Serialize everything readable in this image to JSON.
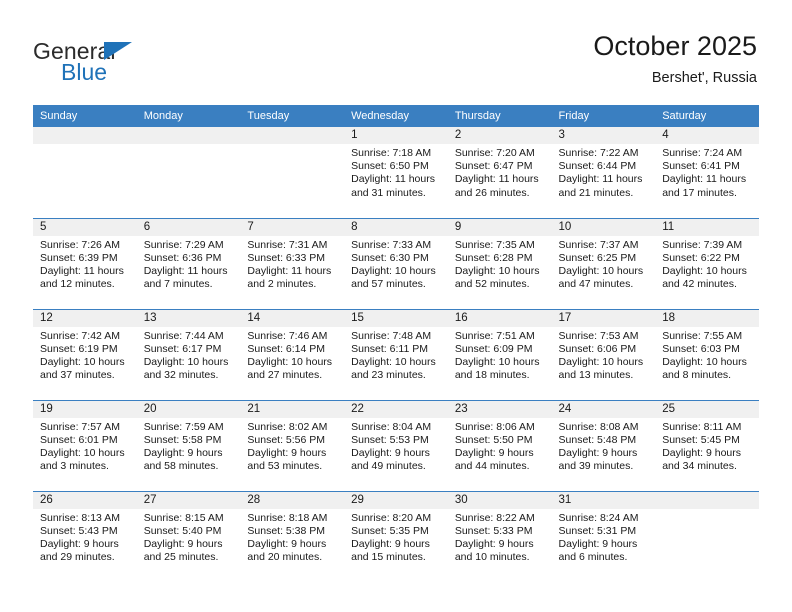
{
  "brand": {
    "name_top": "General",
    "name_bottom": "Blue",
    "accent_color": "#1f72b8",
    "triangle_icon": "brand-triangle-icon"
  },
  "header": {
    "title": "October 2025",
    "subtitle": "Bershet', Russia"
  },
  "calendar": {
    "header_bg": "#3a7fc1",
    "daynum_bg": "#f0f0f0",
    "weekday_headers": [
      "Sunday",
      "Monday",
      "Tuesday",
      "Wednesday",
      "Thursday",
      "Friday",
      "Saturday"
    ],
    "weeks": [
      [
        {
          "day": "",
          "empty": true,
          "sunrise": "",
          "sunset": "",
          "daylight_1": "",
          "daylight_2": ""
        },
        {
          "day": "",
          "empty": true,
          "sunrise": "",
          "sunset": "",
          "daylight_1": "",
          "daylight_2": ""
        },
        {
          "day": "",
          "empty": true,
          "sunrise": "",
          "sunset": "",
          "daylight_1": "",
          "daylight_2": ""
        },
        {
          "day": "1",
          "empty": false,
          "sunrise": "Sunrise: 7:18 AM",
          "sunset": "Sunset: 6:50 PM",
          "daylight_1": "Daylight: 11 hours",
          "daylight_2": "and 31 minutes."
        },
        {
          "day": "2",
          "empty": false,
          "sunrise": "Sunrise: 7:20 AM",
          "sunset": "Sunset: 6:47 PM",
          "daylight_1": "Daylight: 11 hours",
          "daylight_2": "and 26 minutes."
        },
        {
          "day": "3",
          "empty": false,
          "sunrise": "Sunrise: 7:22 AM",
          "sunset": "Sunset: 6:44 PM",
          "daylight_1": "Daylight: 11 hours",
          "daylight_2": "and 21 minutes."
        },
        {
          "day": "4",
          "empty": false,
          "sunrise": "Sunrise: 7:24 AM",
          "sunset": "Sunset: 6:41 PM",
          "daylight_1": "Daylight: 11 hours",
          "daylight_2": "and 17 minutes."
        }
      ],
      [
        {
          "day": "5",
          "empty": false,
          "sunrise": "Sunrise: 7:26 AM",
          "sunset": "Sunset: 6:39 PM",
          "daylight_1": "Daylight: 11 hours",
          "daylight_2": "and 12 minutes."
        },
        {
          "day": "6",
          "empty": false,
          "sunrise": "Sunrise: 7:29 AM",
          "sunset": "Sunset: 6:36 PM",
          "daylight_1": "Daylight: 11 hours",
          "daylight_2": "and 7 minutes."
        },
        {
          "day": "7",
          "empty": false,
          "sunrise": "Sunrise: 7:31 AM",
          "sunset": "Sunset: 6:33 PM",
          "daylight_1": "Daylight: 11 hours",
          "daylight_2": "and 2 minutes."
        },
        {
          "day": "8",
          "empty": false,
          "sunrise": "Sunrise: 7:33 AM",
          "sunset": "Sunset: 6:30 PM",
          "daylight_1": "Daylight: 10 hours",
          "daylight_2": "and 57 minutes."
        },
        {
          "day": "9",
          "empty": false,
          "sunrise": "Sunrise: 7:35 AM",
          "sunset": "Sunset: 6:28 PM",
          "daylight_1": "Daylight: 10 hours",
          "daylight_2": "and 52 minutes."
        },
        {
          "day": "10",
          "empty": false,
          "sunrise": "Sunrise: 7:37 AM",
          "sunset": "Sunset: 6:25 PM",
          "daylight_1": "Daylight: 10 hours",
          "daylight_2": "and 47 minutes."
        },
        {
          "day": "11",
          "empty": false,
          "sunrise": "Sunrise: 7:39 AM",
          "sunset": "Sunset: 6:22 PM",
          "daylight_1": "Daylight: 10 hours",
          "daylight_2": "and 42 minutes."
        }
      ],
      [
        {
          "day": "12",
          "empty": false,
          "sunrise": "Sunrise: 7:42 AM",
          "sunset": "Sunset: 6:19 PM",
          "daylight_1": "Daylight: 10 hours",
          "daylight_2": "and 37 minutes."
        },
        {
          "day": "13",
          "empty": false,
          "sunrise": "Sunrise: 7:44 AM",
          "sunset": "Sunset: 6:17 PM",
          "daylight_1": "Daylight: 10 hours",
          "daylight_2": "and 32 minutes."
        },
        {
          "day": "14",
          "empty": false,
          "sunrise": "Sunrise: 7:46 AM",
          "sunset": "Sunset: 6:14 PM",
          "daylight_1": "Daylight: 10 hours",
          "daylight_2": "and 27 minutes."
        },
        {
          "day": "15",
          "empty": false,
          "sunrise": "Sunrise: 7:48 AM",
          "sunset": "Sunset: 6:11 PM",
          "daylight_1": "Daylight: 10 hours",
          "daylight_2": "and 23 minutes."
        },
        {
          "day": "16",
          "empty": false,
          "sunrise": "Sunrise: 7:51 AM",
          "sunset": "Sunset: 6:09 PM",
          "daylight_1": "Daylight: 10 hours",
          "daylight_2": "and 18 minutes."
        },
        {
          "day": "17",
          "empty": false,
          "sunrise": "Sunrise: 7:53 AM",
          "sunset": "Sunset: 6:06 PM",
          "daylight_1": "Daylight: 10 hours",
          "daylight_2": "and 13 minutes."
        },
        {
          "day": "18",
          "empty": false,
          "sunrise": "Sunrise: 7:55 AM",
          "sunset": "Sunset: 6:03 PM",
          "daylight_1": "Daylight: 10 hours",
          "daylight_2": "and 8 minutes."
        }
      ],
      [
        {
          "day": "19",
          "empty": false,
          "sunrise": "Sunrise: 7:57 AM",
          "sunset": "Sunset: 6:01 PM",
          "daylight_1": "Daylight: 10 hours",
          "daylight_2": "and 3 minutes."
        },
        {
          "day": "20",
          "empty": false,
          "sunrise": "Sunrise: 7:59 AM",
          "sunset": "Sunset: 5:58 PM",
          "daylight_1": "Daylight: 9 hours",
          "daylight_2": "and 58 minutes."
        },
        {
          "day": "21",
          "empty": false,
          "sunrise": "Sunrise: 8:02 AM",
          "sunset": "Sunset: 5:56 PM",
          "daylight_1": "Daylight: 9 hours",
          "daylight_2": "and 53 minutes."
        },
        {
          "day": "22",
          "empty": false,
          "sunrise": "Sunrise: 8:04 AM",
          "sunset": "Sunset: 5:53 PM",
          "daylight_1": "Daylight: 9 hours",
          "daylight_2": "and 49 minutes."
        },
        {
          "day": "23",
          "empty": false,
          "sunrise": "Sunrise: 8:06 AM",
          "sunset": "Sunset: 5:50 PM",
          "daylight_1": "Daylight: 9 hours",
          "daylight_2": "and 44 minutes."
        },
        {
          "day": "24",
          "empty": false,
          "sunrise": "Sunrise: 8:08 AM",
          "sunset": "Sunset: 5:48 PM",
          "daylight_1": "Daylight: 9 hours",
          "daylight_2": "and 39 minutes."
        },
        {
          "day": "25",
          "empty": false,
          "sunrise": "Sunrise: 8:11 AM",
          "sunset": "Sunset: 5:45 PM",
          "daylight_1": "Daylight: 9 hours",
          "daylight_2": "and 34 minutes."
        }
      ],
      [
        {
          "day": "26",
          "empty": false,
          "sunrise": "Sunrise: 8:13 AM",
          "sunset": "Sunset: 5:43 PM",
          "daylight_1": "Daylight: 9 hours",
          "daylight_2": "and 29 minutes."
        },
        {
          "day": "27",
          "empty": false,
          "sunrise": "Sunrise: 8:15 AM",
          "sunset": "Sunset: 5:40 PM",
          "daylight_1": "Daylight: 9 hours",
          "daylight_2": "and 25 minutes."
        },
        {
          "day": "28",
          "empty": false,
          "sunrise": "Sunrise: 8:18 AM",
          "sunset": "Sunset: 5:38 PM",
          "daylight_1": "Daylight: 9 hours",
          "daylight_2": "and 20 minutes."
        },
        {
          "day": "29",
          "empty": false,
          "sunrise": "Sunrise: 8:20 AM",
          "sunset": "Sunset: 5:35 PM",
          "daylight_1": "Daylight: 9 hours",
          "daylight_2": "and 15 minutes."
        },
        {
          "day": "30",
          "empty": false,
          "sunrise": "Sunrise: 8:22 AM",
          "sunset": "Sunset: 5:33 PM",
          "daylight_1": "Daylight: 9 hours",
          "daylight_2": "and 10 minutes."
        },
        {
          "day": "31",
          "empty": false,
          "sunrise": "Sunrise: 8:24 AM",
          "sunset": "Sunset: 5:31 PM",
          "daylight_1": "Daylight: 9 hours",
          "daylight_2": "and 6 minutes."
        },
        {
          "day": "",
          "empty": true,
          "sunrise": "",
          "sunset": "",
          "daylight_1": "",
          "daylight_2": ""
        }
      ]
    ]
  }
}
